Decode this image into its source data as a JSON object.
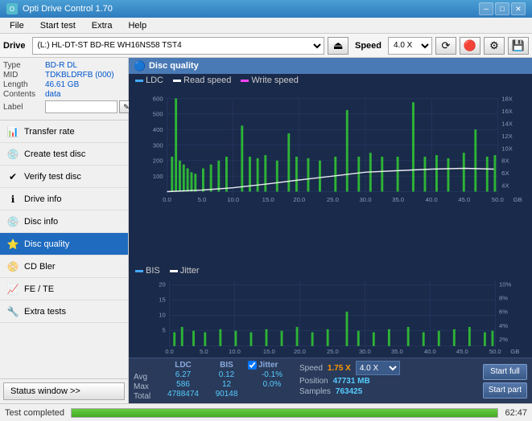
{
  "titlebar": {
    "title": "Opti Drive Control 1.70",
    "minimize_label": "─",
    "maximize_label": "□",
    "close_label": "✕"
  },
  "menubar": {
    "items": [
      "File",
      "Start test",
      "Extra",
      "Help"
    ]
  },
  "drivebar": {
    "drive_label": "Drive",
    "drive_value": "(L:)  HL-DT-ST BD-RE  WH16NS58 TST4",
    "speed_label": "Speed",
    "speed_value": "4.0 X"
  },
  "disc": {
    "type_label": "Type",
    "type_value": "BD-R DL",
    "mid_label": "MID",
    "mid_value": "TDKBLDRFB (000)",
    "length_label": "Length",
    "length_value": "46.61 GB",
    "contents_label": "Contents",
    "contents_value": "data",
    "label_label": "Label"
  },
  "nav": {
    "items": [
      {
        "id": "transfer-rate",
        "label": "Transfer rate",
        "icon": "📊"
      },
      {
        "id": "create-test-disc",
        "label": "Create test disc",
        "icon": "💿"
      },
      {
        "id": "verify-test-disc",
        "label": "Verify test disc",
        "icon": "✔"
      },
      {
        "id": "drive-info",
        "label": "Drive info",
        "icon": "ℹ"
      },
      {
        "id": "disc-info",
        "label": "Disc info",
        "icon": "💿"
      },
      {
        "id": "disc-quality",
        "label": "Disc quality",
        "icon": "⭐",
        "active": true
      },
      {
        "id": "cd-bler",
        "label": "CD Bler",
        "icon": "📀"
      },
      {
        "id": "fe-te",
        "label": "FE / TE",
        "icon": "📈"
      },
      {
        "id": "extra-tests",
        "label": "Extra tests",
        "icon": "🔧"
      }
    ],
    "status_window_label": "Status window >>",
    "status_chevron": ">>"
  },
  "chart": {
    "title": "Disc quality",
    "title_icon": "🔵",
    "top_legend": {
      "ldc_label": "LDC",
      "read_speed_label": "Read speed",
      "write_speed_label": "Write speed"
    },
    "bottom_legend": {
      "bis_label": "BIS",
      "jitter_label": "Jitter"
    },
    "x_axis_label": "GB",
    "top_y_right_max": "18X",
    "bottom_y_right_max": "10%"
  },
  "stats": {
    "ldc_label": "LDC",
    "bis_label": "BIS",
    "jitter_label": "Jitter",
    "speed_label": "Speed",
    "speed_value": "1.75 X",
    "speed_select": "4.0 X",
    "position_label": "Position",
    "position_value": "47731 MB",
    "samples_label": "Samples",
    "samples_value": "763425",
    "avg_label": "Avg",
    "avg_ldc": "6.27",
    "avg_bis": "0.12",
    "avg_jitter": "-0.1%",
    "max_label": "Max",
    "max_ldc": "586",
    "max_bis": "12",
    "max_jitter": "0.0%",
    "total_label": "Total",
    "total_ldc": "4788474",
    "total_bis": "90148",
    "start_full_label": "Start full",
    "start_part_label": "Start part",
    "jitter_checked": true
  },
  "statusbar": {
    "status_text": "Test completed",
    "progress_percent": 100,
    "time_text": "62:47"
  }
}
